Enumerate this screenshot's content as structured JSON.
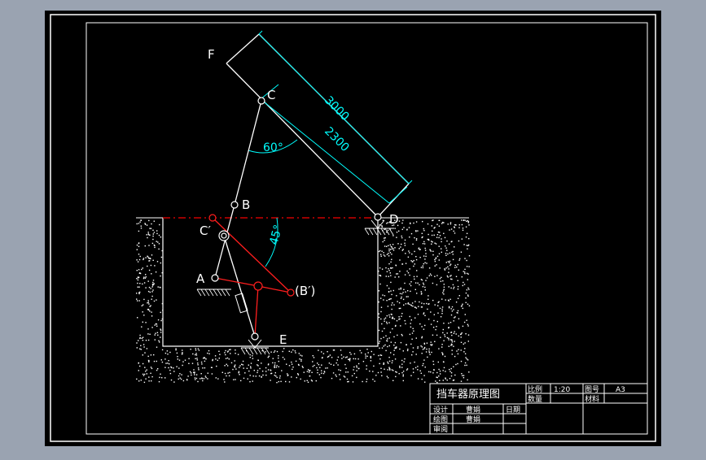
{
  "colors": {
    "workspace_bg": "#9aa3b1",
    "drawing_bg": "#000000",
    "frame": "#ffffff",
    "dimension": "#00ffff",
    "red_state": "#ff1e1e",
    "red_dash": "#cc0000",
    "text": "#ffffff"
  },
  "labels": {
    "F": "F",
    "C": "C",
    "B": "B",
    "D": "D",
    "C_prime": "C′",
    "A": "A",
    "B_prime": "(B′)",
    "E": "E"
  },
  "dimensions": {
    "length_outer": "3000",
    "length_inner": "2300",
    "angle_60": "60°",
    "angle_45": "45°"
  },
  "title_block": {
    "title": "挡车器原理图",
    "scale_label": "比例",
    "scale_value": "1:20",
    "drawing_no_label": "图号",
    "drawing_no_value": "A3",
    "quantity_label": "数量",
    "material_label": "材料",
    "design_label": "设计",
    "design_name": "曹娟",
    "date_label": "日期",
    "drafting_label": "绘图",
    "drafting_name": "曹娟",
    "review_label": "审阅"
  }
}
